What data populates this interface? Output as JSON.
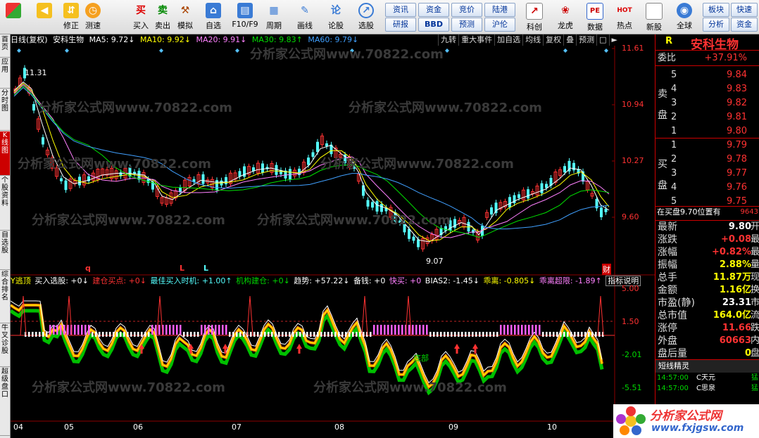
{
  "toolbar": {
    "buttons": [
      {
        "icon": "grid-icon",
        "label": ""
      },
      {
        "icon": "back-arrow-icon",
        "label": ""
      },
      {
        "icon": "up-down-icon",
        "label": "修正"
      },
      {
        "icon": "clock-icon",
        "label": "测速"
      },
      {
        "icon": "buy-icon",
        "label": "买入",
        "glyph": "买"
      },
      {
        "icon": "sell-icon",
        "label": "卖出",
        "glyph": "卖"
      },
      {
        "icon": "hammer-icon",
        "label": "模拟"
      },
      {
        "icon": "home-icon",
        "label": "自选"
      },
      {
        "icon": "monitor-icon",
        "label": "F10/F9"
      },
      {
        "icon": "period-icon",
        "label": "周期"
      },
      {
        "icon": "pen-icon",
        "label": "画线"
      },
      {
        "icon": "forum-icon",
        "label": "论股",
        "glyph": "论"
      },
      {
        "icon": "select-stock-icon",
        "label": "选股"
      }
    ],
    "small_buttons": [
      "资讯",
      "资金",
      "竞价",
      "陆港",
      "研报",
      "BBD",
      "预测",
      "沪伦"
    ],
    "right_buttons": [
      {
        "icon": "chart-icon",
        "label": "科创"
      },
      {
        "icon": "dragon-icon",
        "label": "龙虎"
      },
      {
        "icon": "pe-icon",
        "label": "数据",
        "glyph": "PE"
      },
      {
        "icon": "hot-icon",
        "label": "热点",
        "glyph": "HOT"
      },
      {
        "icon": "new-stock-icon",
        "label": "新股"
      },
      {
        "icon": "globe-icon",
        "label": "全球"
      }
    ],
    "side_buttons": [
      "板块",
      "快速",
      "分析",
      "资金"
    ]
  },
  "left_strip": [
    "首页",
    "应用",
    "分时图",
    "K线图",
    "个股资料",
    "自选股",
    "综合排名",
    "牛叉诊股",
    "超级盘口"
  ],
  "chart_title": {
    "mode": "日线(复权)",
    "name": "安科生物",
    "ma5": "MA5: 9.72↓",
    "ma10": "MA10: 9.92↓",
    "ma20": "MA20: 9.91↓",
    "ma30": "MA30: 9.83↑",
    "ma60": "MA60: 9.79↓"
  },
  "top_buttons": [
    "九转",
    "重大事件",
    "加自选",
    "均线",
    "复权",
    "叠",
    "预测"
  ],
  "price_axis": [
    "11.61",
    "10.94",
    "10.27",
    "9.60"
  ],
  "annotations": {
    "high": "11.31",
    "low": "9.07",
    "cai": "财",
    "q": "q",
    "L1": "L",
    "L2": "L"
  },
  "indicator_bar": {
    "title": "Y逃顶",
    "buy_select": "买入选股: +0↓",
    "build_buy": "建仓买点: +0↓",
    "best_buy": "最佳买入时机: +1.00↑",
    "inst_build": "机构建仓: +0↓",
    "trend": "趋势: +57.22↓",
    "reserve": "备钱: +0",
    "quick_buy": "快买: +0",
    "bias2": "BIAS2: -1.45↓",
    "deviation": "乖离: -0.805↓",
    "deviation_super": "乖离超限: -1.89↑",
    "explain": "指标说明"
  },
  "ind_axis": [
    "5.00",
    "1.50",
    "-2.01",
    "-5.51"
  ],
  "bottom_label": "底部",
  "months": [
    "04",
    "05",
    "06",
    "07",
    "08",
    "09",
    "10"
  ],
  "watermark": "分析家公式网www.70822.com",
  "right_panel": {
    "letter": "R",
    "stock_name": "安科生物",
    "weibi_label": "委比",
    "weibi_value": "+37.91%",
    "sell_label": "卖盘",
    "buy_label": "买盘",
    "sells": [
      {
        "level": "5",
        "price": "9.84"
      },
      {
        "level": "4",
        "price": "9.83"
      },
      {
        "level": "3",
        "price": "9.82"
      },
      {
        "level": "2",
        "price": "9.81"
      },
      {
        "level": "1",
        "price": "9.80"
      }
    ],
    "buys": [
      {
        "level": "1",
        "price": "9.79"
      },
      {
        "level": "2",
        "price": "9.78"
      },
      {
        "level": "3",
        "price": "9.77"
      },
      {
        "level": "4",
        "price": "9.76"
      },
      {
        "level": "5",
        "price": "9.75"
      }
    ],
    "on_buy_text": "在买盘9.70位置有",
    "on_buy_value": "9643",
    "stats": [
      {
        "label": "最新",
        "value": "9.80",
        "suffix": "开",
        "color": "white"
      },
      {
        "label": "涨跌",
        "value": "+0.08",
        "suffix": "最",
        "color": "red"
      },
      {
        "label": "涨幅",
        "value": "+0.82%",
        "suffix": "最",
        "color": "red"
      },
      {
        "label": "振幅",
        "value": "2.88%",
        "suffix": "量",
        "color": "yellow"
      },
      {
        "label": "总手",
        "value": "11.87万",
        "suffix": "现",
        "color": "yellow"
      },
      {
        "label": "金额",
        "value": "1.16亿",
        "suffix": "换",
        "color": "yellow"
      },
      {
        "label": "市盈(静)",
        "value": "23.31",
        "suffix": "市",
        "color": "white"
      },
      {
        "label": "总市值",
        "value": "164.0亿",
        "suffix": "流",
        "color": "yellow"
      },
      {
        "label": "涨停",
        "value": "11.66",
        "suffix": "跌",
        "color": "red"
      },
      {
        "label": "外盘",
        "value": "60663",
        "suffix": "内",
        "color": "red"
      },
      {
        "label": "盘后量",
        "value": "0",
        "suffix": "盘",
        "color": "yellow"
      }
    ],
    "short_title": "短线精灵",
    "short_items": [
      {
        "time": "14:57:00",
        "name": "C天元",
        "tag": "猛"
      },
      {
        "time": "14:57:00",
        "name": "C思泉",
        "tag": "猛"
      }
    ]
  },
  "logo": {
    "title": "分析家公式网",
    "url": "www.fxjgsw.com"
  },
  "colors": {
    "up": "#ff3232",
    "down": "#54fcfc",
    "ma5": "#ffffff",
    "ma10": "#ffff00",
    "ma20": "#ff80ff",
    "ma30": "#00e000",
    "ma60": "#40a0ff",
    "grid": "#8b0000"
  }
}
